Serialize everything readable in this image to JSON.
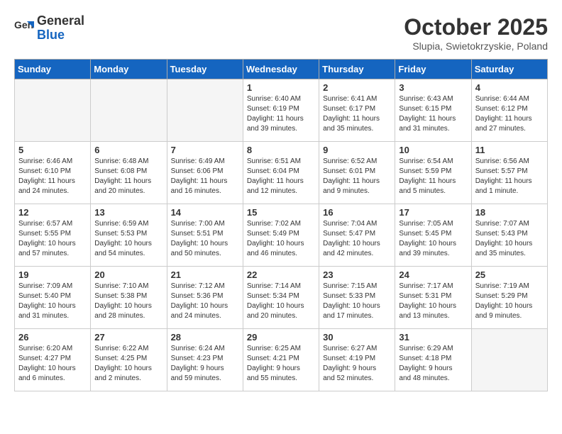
{
  "header": {
    "logo_general": "General",
    "logo_blue": "Blue",
    "month": "October 2025",
    "location": "Slupia, Swietokrzyskie, Poland"
  },
  "weekdays": [
    "Sunday",
    "Monday",
    "Tuesday",
    "Wednesday",
    "Thursday",
    "Friday",
    "Saturday"
  ],
  "weeks": [
    [
      {
        "day": "",
        "info": ""
      },
      {
        "day": "",
        "info": ""
      },
      {
        "day": "",
        "info": ""
      },
      {
        "day": "1",
        "info": "Sunrise: 6:40 AM\nSunset: 6:19 PM\nDaylight: 11 hours\nand 39 minutes."
      },
      {
        "day": "2",
        "info": "Sunrise: 6:41 AM\nSunset: 6:17 PM\nDaylight: 11 hours\nand 35 minutes."
      },
      {
        "day": "3",
        "info": "Sunrise: 6:43 AM\nSunset: 6:15 PM\nDaylight: 11 hours\nand 31 minutes."
      },
      {
        "day": "4",
        "info": "Sunrise: 6:44 AM\nSunset: 6:12 PM\nDaylight: 11 hours\nand 27 minutes."
      }
    ],
    [
      {
        "day": "5",
        "info": "Sunrise: 6:46 AM\nSunset: 6:10 PM\nDaylight: 11 hours\nand 24 minutes."
      },
      {
        "day": "6",
        "info": "Sunrise: 6:48 AM\nSunset: 6:08 PM\nDaylight: 11 hours\nand 20 minutes."
      },
      {
        "day": "7",
        "info": "Sunrise: 6:49 AM\nSunset: 6:06 PM\nDaylight: 11 hours\nand 16 minutes."
      },
      {
        "day": "8",
        "info": "Sunrise: 6:51 AM\nSunset: 6:04 PM\nDaylight: 11 hours\nand 12 minutes."
      },
      {
        "day": "9",
        "info": "Sunrise: 6:52 AM\nSunset: 6:01 PM\nDaylight: 11 hours\nand 9 minutes."
      },
      {
        "day": "10",
        "info": "Sunrise: 6:54 AM\nSunset: 5:59 PM\nDaylight: 11 hours\nand 5 minutes."
      },
      {
        "day": "11",
        "info": "Sunrise: 6:56 AM\nSunset: 5:57 PM\nDaylight: 11 hours\nand 1 minute."
      }
    ],
    [
      {
        "day": "12",
        "info": "Sunrise: 6:57 AM\nSunset: 5:55 PM\nDaylight: 10 hours\nand 57 minutes."
      },
      {
        "day": "13",
        "info": "Sunrise: 6:59 AM\nSunset: 5:53 PM\nDaylight: 10 hours\nand 54 minutes."
      },
      {
        "day": "14",
        "info": "Sunrise: 7:00 AM\nSunset: 5:51 PM\nDaylight: 10 hours\nand 50 minutes."
      },
      {
        "day": "15",
        "info": "Sunrise: 7:02 AM\nSunset: 5:49 PM\nDaylight: 10 hours\nand 46 minutes."
      },
      {
        "day": "16",
        "info": "Sunrise: 7:04 AM\nSunset: 5:47 PM\nDaylight: 10 hours\nand 42 minutes."
      },
      {
        "day": "17",
        "info": "Sunrise: 7:05 AM\nSunset: 5:45 PM\nDaylight: 10 hours\nand 39 minutes."
      },
      {
        "day": "18",
        "info": "Sunrise: 7:07 AM\nSunset: 5:43 PM\nDaylight: 10 hours\nand 35 minutes."
      }
    ],
    [
      {
        "day": "19",
        "info": "Sunrise: 7:09 AM\nSunset: 5:40 PM\nDaylight: 10 hours\nand 31 minutes."
      },
      {
        "day": "20",
        "info": "Sunrise: 7:10 AM\nSunset: 5:38 PM\nDaylight: 10 hours\nand 28 minutes."
      },
      {
        "day": "21",
        "info": "Sunrise: 7:12 AM\nSunset: 5:36 PM\nDaylight: 10 hours\nand 24 minutes."
      },
      {
        "day": "22",
        "info": "Sunrise: 7:14 AM\nSunset: 5:34 PM\nDaylight: 10 hours\nand 20 minutes."
      },
      {
        "day": "23",
        "info": "Sunrise: 7:15 AM\nSunset: 5:33 PM\nDaylight: 10 hours\nand 17 minutes."
      },
      {
        "day": "24",
        "info": "Sunrise: 7:17 AM\nSunset: 5:31 PM\nDaylight: 10 hours\nand 13 minutes."
      },
      {
        "day": "25",
        "info": "Sunrise: 7:19 AM\nSunset: 5:29 PM\nDaylight: 10 hours\nand 9 minutes."
      }
    ],
    [
      {
        "day": "26",
        "info": "Sunrise: 6:20 AM\nSunset: 4:27 PM\nDaylight: 10 hours\nand 6 minutes."
      },
      {
        "day": "27",
        "info": "Sunrise: 6:22 AM\nSunset: 4:25 PM\nDaylight: 10 hours\nand 2 minutes."
      },
      {
        "day": "28",
        "info": "Sunrise: 6:24 AM\nSunset: 4:23 PM\nDaylight: 9 hours\nand 59 minutes."
      },
      {
        "day": "29",
        "info": "Sunrise: 6:25 AM\nSunset: 4:21 PM\nDaylight: 9 hours\nand 55 minutes."
      },
      {
        "day": "30",
        "info": "Sunrise: 6:27 AM\nSunset: 4:19 PM\nDaylight: 9 hours\nand 52 minutes."
      },
      {
        "day": "31",
        "info": "Sunrise: 6:29 AM\nSunset: 4:18 PM\nDaylight: 9 hours\nand 48 minutes."
      },
      {
        "day": "",
        "info": ""
      }
    ]
  ]
}
